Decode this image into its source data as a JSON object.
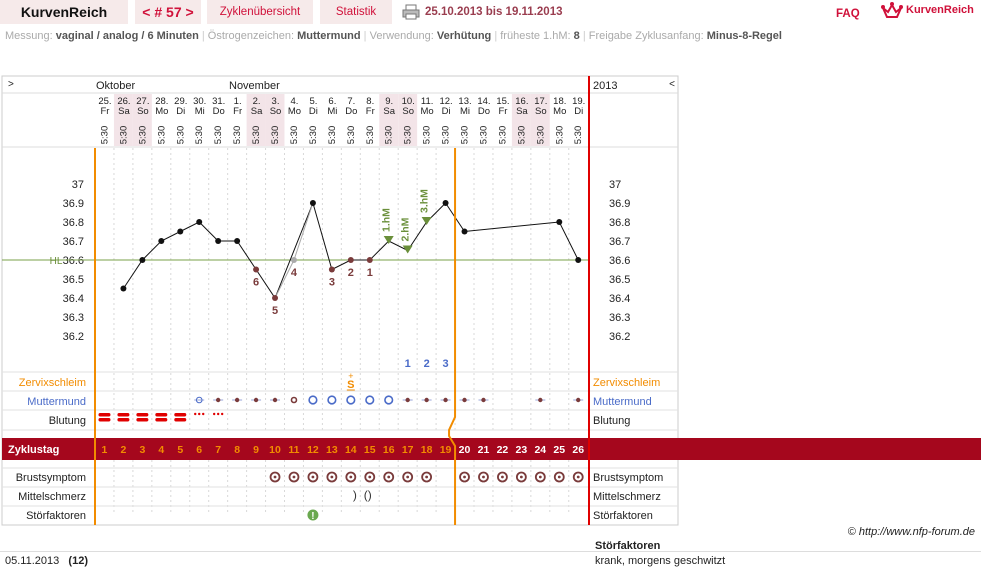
{
  "header": {
    "brand": "KurvenReich",
    "cycle": "< # 57 >",
    "nav_overview": "Zyklenübersicht",
    "nav_stats": "Statistik",
    "date_range": "25.10.2013 bis 19.11.2013",
    "faq": "FAQ",
    "logo": "KurvenReich"
  },
  "info": {
    "measure_label": "Messung:",
    "measure_value": "vaginal / analog / 6 Minuten",
    "sign_label": "Östrogenzeichen:",
    "sign_value": "Muttermund",
    "use_label": "Verwendung:",
    "use_value": "Verhütung",
    "hm_label": "früheste 1.hM:",
    "hm_value": "8",
    "release_label": "Freigabe Zyklusanfang:",
    "release_value": "Minus-8-Regel"
  },
  "chart_data": {
    "type": "line",
    "months": [
      "Oktober",
      "November"
    ],
    "year": "2013",
    "nav_left": ">",
    "nav_right": "<",
    "days": [
      {
        "d": "25.",
        "w": "Fr"
      },
      {
        "d": "26.",
        "w": "Sa"
      },
      {
        "d": "27.",
        "w": "So"
      },
      {
        "d": "28.",
        "w": "Mo"
      },
      {
        "d": "29.",
        "w": "Di"
      },
      {
        "d": "30.",
        "w": "Mi"
      },
      {
        "d": "31.",
        "w": "Do"
      },
      {
        "d": "1.",
        "w": "Fr"
      },
      {
        "d": "2.",
        "w": "Sa"
      },
      {
        "d": "3.",
        "w": "So"
      },
      {
        "d": "4.",
        "w": "Mo"
      },
      {
        "d": "5.",
        "w": "Di"
      },
      {
        "d": "6.",
        "w": "Mi"
      },
      {
        "d": "7.",
        "w": "Do"
      },
      {
        "d": "8.",
        "w": "Fr"
      },
      {
        "d": "9.",
        "w": "Sa"
      },
      {
        "d": "10.",
        "w": "So"
      },
      {
        "d": "11.",
        "w": "Mo"
      },
      {
        "d": "12.",
        "w": "Di"
      },
      {
        "d": "13.",
        "w": "Mi"
      },
      {
        "d": "14.",
        "w": "Do"
      },
      {
        "d": "15.",
        "w": "Fr"
      },
      {
        "d": "16.",
        "w": "Sa"
      },
      {
        "d": "17.",
        "w": "So"
      },
      {
        "d": "18.",
        "w": "Mo"
      },
      {
        "d": "19.",
        "w": "Di"
      }
    ],
    "time": "5:30",
    "y_ticks": [
      "37",
      "36.9",
      "36.8",
      "36.7",
      "36.6",
      "36.5",
      "36.4",
      "36.3",
      "36.2"
    ],
    "ylim": [
      36.1,
      37.05
    ],
    "hl_label": "HL",
    "hl_value": 36.6,
    "temperatures": [
      null,
      36.45,
      36.6,
      36.7,
      36.75,
      36.8,
      36.7,
      36.7,
      36.55,
      36.4,
      36.6,
      36.9,
      36.55,
      36.6,
      36.6,
      36.7,
      36.65,
      36.8,
      36.9,
      36.75,
      null,
      null,
      null,
      null,
      36.8,
      36.6
    ],
    "excluded_days": [
      11
    ],
    "low_labels": [
      {
        "day": 9,
        "text": "6"
      },
      {
        "day": 10,
        "text": "5"
      },
      {
        "day": 11,
        "text": "4"
      },
      {
        "day": 13,
        "text": "3"
      },
      {
        "day": 14,
        "text": "2"
      },
      {
        "day": 15,
        "text": "1"
      }
    ],
    "high_labels": [
      {
        "day": 16,
        "text": "1.hM"
      },
      {
        "day": 17,
        "text": "2.hM"
      },
      {
        "day": 18,
        "text": "3.hM"
      }
    ],
    "blue_counts": [
      {
        "day": 17,
        "text": "1"
      },
      {
        "day": 18,
        "text": "2"
      },
      {
        "day": 19,
        "text": "3"
      }
    ],
    "cycle_days": [
      "1",
      "2",
      "3",
      "4",
      "5",
      "6",
      "7",
      "8",
      "9",
      "10",
      "11",
      "12",
      "13",
      "14",
      "15",
      "16",
      "17",
      "18",
      "19",
      "20",
      "21",
      "22",
      "23",
      "24",
      "25",
      "26"
    ],
    "rows": {
      "zervix": "Zervixschleim",
      "muttermund": "Muttermund",
      "blutung": "Blutung",
      "zyklustag": "Zyklustag",
      "brust": "Brustsymptom",
      "mittel": "Mittelschmerz",
      "stoer": "Störfaktoren"
    },
    "zervix_mark": {
      "day": 14,
      "text": "S"
    },
    "bleeding_heavy_days": [
      1,
      2,
      3,
      4,
      5
    ],
    "bleeding_spot_days": [
      6,
      7
    ],
    "mm_open_days": [
      11,
      12,
      13,
      14,
      15,
      16
    ],
    "mm_closed_days": [
      6,
      7,
      8,
      9,
      10,
      17,
      18,
      19,
      20,
      21,
      24,
      26
    ],
    "brust_days": [
      10,
      11,
      12,
      13,
      14,
      15,
      16,
      17,
      18,
      20,
      21,
      22,
      23,
      24,
      25,
      26
    ],
    "mittel_days": [
      14,
      15
    ],
    "stoer_days": [
      12
    ],
    "colors": {
      "brand": "#d0113a",
      "cyclebar": "#a5071d",
      "orange": "#f28c00",
      "red": "#e00000",
      "green": "#6a8f3a",
      "blue": "#4a6bc8",
      "darkred": "#7a3b3b"
    }
  },
  "footer": {
    "copyright": "© http://www.nfp-forum.de",
    "date": "05.11.2013",
    "count": "(12)",
    "heading": "Störfaktoren",
    "note": "krank, morgens geschwitzt"
  }
}
